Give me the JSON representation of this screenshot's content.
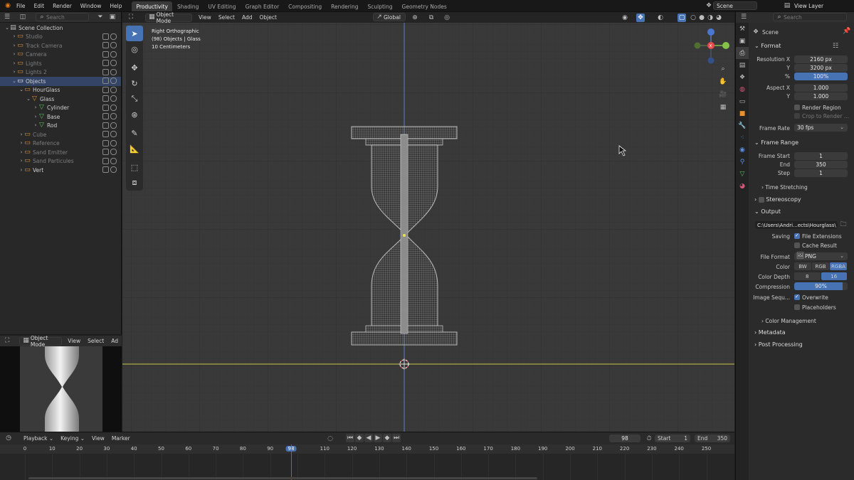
{
  "top_menu": [
    "File",
    "Edit",
    "Render",
    "Window",
    "Help"
  ],
  "workspaces": [
    {
      "label": "Productivity",
      "active": true
    },
    {
      "label": "Shading",
      "active": false
    },
    {
      "label": "UV Editing",
      "active": false
    },
    {
      "label": "Graph Editor",
      "active": false
    },
    {
      "label": "Compositing",
      "active": false
    },
    {
      "label": "Rendering",
      "active": false
    },
    {
      "label": "Sculpting",
      "active": false
    },
    {
      "label": "Geometry Nodes",
      "active": false
    }
  ],
  "scene_field": "Scene",
  "view_layer_field": "View Layer",
  "outliner": {
    "search_placeholder": "Search",
    "items": [
      {
        "label": "Scene Collection",
        "indent": 0,
        "dim": false,
        "sel": false
      },
      {
        "label": "Studio",
        "indent": 1,
        "dim": true,
        "sel": false
      },
      {
        "label": "Track Camera",
        "indent": 1,
        "dim": true,
        "sel": false
      },
      {
        "label": "Camera",
        "indent": 1,
        "dim": true,
        "sel": false
      },
      {
        "label": "Lights",
        "indent": 1,
        "dim": true,
        "sel": false
      },
      {
        "label": "Lights 2",
        "indent": 1,
        "dim": true,
        "sel": false
      },
      {
        "label": "Objects",
        "indent": 1,
        "dim": false,
        "sel": true
      },
      {
        "label": "HourGlass",
        "indent": 2,
        "dim": false,
        "sel": false
      },
      {
        "label": "Glass",
        "indent": 3,
        "dim": false,
        "sel": false
      },
      {
        "label": "Cylinder",
        "indent": 4,
        "dim": false,
        "sel": false
      },
      {
        "label": "Base",
        "indent": 4,
        "dim": false,
        "sel": false
      },
      {
        "label": "Rod",
        "indent": 4,
        "dim": false,
        "sel": false
      },
      {
        "label": "Cube",
        "indent": 2,
        "dim": true,
        "sel": false
      },
      {
        "label": "Reference",
        "indent": 2,
        "dim": true,
        "sel": false
      },
      {
        "label": "Sand Emitter",
        "indent": 2,
        "dim": true,
        "sel": false
      },
      {
        "label": "Sand Particules",
        "indent": 2,
        "dim": true,
        "sel": false
      },
      {
        "label": "Vert",
        "indent": 2,
        "dim": false,
        "sel": false
      }
    ]
  },
  "viewport": {
    "mode": "Object Mode",
    "menus": [
      "View",
      "Select",
      "Add",
      "Object"
    ],
    "transform_orientation": "Global",
    "overlay_line1": "Right Orthographic",
    "overlay_line2": "(98) Objects | Glass",
    "overlay_line3": "10 Centimeters"
  },
  "preview": {
    "mode": "Object Mode",
    "menus": [
      "View",
      "Select",
      "Ad"
    ]
  },
  "properties": {
    "search_placeholder": "Search",
    "scene_label": "Scene",
    "format_header": "Format",
    "resolution_x_label": "Resolution X",
    "resolution_x": "2160 px",
    "resolution_y_label": "Y",
    "resolution_y": "3200 px",
    "percent_label": "%",
    "percent": "100%",
    "aspect_x_label": "Aspect X",
    "aspect_x": "1.000",
    "aspect_y_label": "Y",
    "aspect_y": "1.000",
    "render_region": "Render Region",
    "crop_to_render": "Crop to Render ...",
    "frame_rate_label": "Frame Rate",
    "frame_rate": "30 fps",
    "frame_range_header": "Frame Range",
    "frame_start_label": "Frame Start",
    "frame_start": "1",
    "end_label": "End",
    "end": "350",
    "step_label": "Step",
    "step": "1",
    "time_stretching": "Time Stretching",
    "stereoscopy": "Stereoscopy",
    "output_header": "Output",
    "output_path": "C:\\Users\\Andri...ects\\Hourglass\\",
    "saving_label": "Saving",
    "file_extensions": "File Extensions",
    "cache_result": "Cache Result",
    "file_format_label": "File Format",
    "file_format": "PNG",
    "color_label": "Color",
    "color_opts": [
      "BW",
      "RGB",
      "RGBA"
    ],
    "color_depth_label": "Color Depth",
    "color_depth_opts": [
      "8",
      "16"
    ],
    "compression_label": "Compression",
    "compression": "90%",
    "image_seq_label": "Image Sequ...",
    "overwrite": "Overwrite",
    "placeholders": "Placeholders",
    "color_management": "Color Management",
    "metadata": "Metadata",
    "post_processing": "Post Processing"
  },
  "timeline": {
    "menus": [
      "Playback",
      "Keying",
      "View",
      "Marker"
    ],
    "current_frame": "98",
    "start_label": "Start",
    "start": "1",
    "end_label": "End",
    "end": "350",
    "ticks": [
      "0",
      "10",
      "20",
      "30",
      "40",
      "50",
      "60",
      "70",
      "80",
      "90",
      "98",
      "110",
      "120",
      "130",
      "140",
      "150",
      "160",
      "170",
      "180",
      "190",
      "200",
      "210",
      "220",
      "230",
      "240",
      "250"
    ]
  },
  "colors": {
    "accent": "#4772b3",
    "x_axis": "#c9c34a",
    "z_axis": "#5a7fc6"
  }
}
